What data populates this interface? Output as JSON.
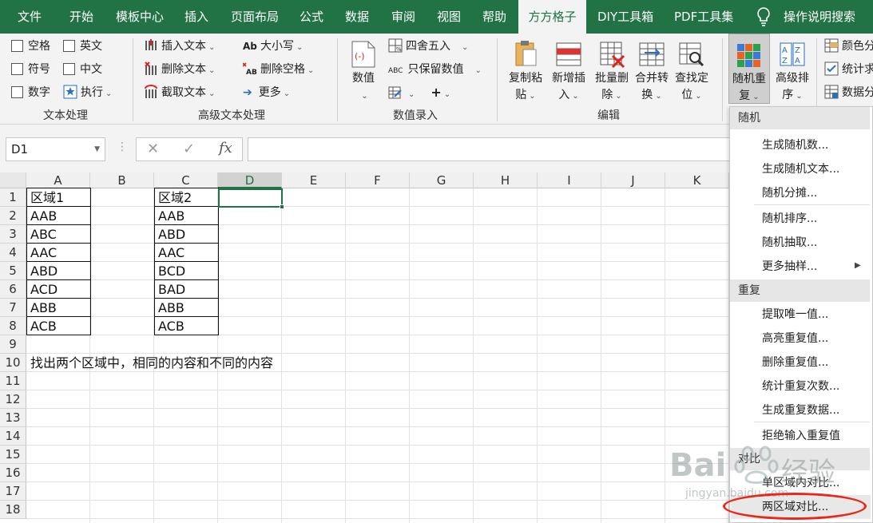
{
  "tabs": [
    "文件",
    "开始",
    "模板中心",
    "插入",
    "页面布局",
    "公式",
    "数据",
    "审阅",
    "视图",
    "帮助",
    "方方格子",
    "DIY工具箱",
    "PDF工具集"
  ],
  "help_label": "操作说明搜索",
  "ribbon": {
    "text": {
      "items": [
        "空格",
        "英文",
        "符号",
        "中文",
        "数字",
        "执行"
      ],
      "group": "文本处理"
    },
    "adv": {
      "items": [
        "插入文本",
        "删除文本",
        "截取文本",
        "大小写",
        "删除空格",
        "更多"
      ],
      "group": "高级文本处理"
    },
    "num": {
      "big": "数值",
      "items": [
        "四舍五入",
        "只保留数值"
      ],
      "group": "数值录入"
    },
    "edit": {
      "buttons": [
        [
          "复制粘",
          "贴"
        ],
        [
          "新增插",
          "入"
        ],
        [
          "批量删",
          "除"
        ],
        [
          "合并转",
          "换"
        ],
        [
          "查找定",
          "位"
        ]
      ],
      "group": "编辑"
    },
    "rand": {
      "buttons": [
        [
          "随机重",
          "复"
        ],
        [
          "高级排",
          "序"
        ]
      ]
    },
    "right": [
      "颜色分",
      "统计求",
      "数据分"
    ]
  },
  "namebox": "D1",
  "columns": [
    "A",
    "B",
    "C",
    "D",
    "E",
    "F",
    "G",
    "H",
    "I",
    "J",
    "K"
  ],
  "rows": [
    "1",
    "2",
    "3",
    "4",
    "5",
    "6",
    "7",
    "8",
    "9",
    "10",
    "11",
    "12",
    "13",
    "14",
    "15",
    "16",
    "17",
    "18"
  ],
  "colA": [
    "区域1",
    "AAB",
    "ABC",
    "AAC",
    "ABD",
    "ACD",
    "ABB",
    "ACB"
  ],
  "colC": [
    "区域2",
    "AAB",
    "ABD",
    "AAC",
    "BCD",
    "BAD",
    "ABB",
    "ACB"
  ],
  "note": "找出两个区域中，相同的内容和不同的内容",
  "menu": {
    "h1": "随机",
    "g1": [
      "生成随机数...",
      "生成随机文本...",
      "随机分摊..."
    ],
    "g2": [
      "随机排序...",
      "随机抽取...",
      "更多抽样..."
    ],
    "h2": "重复",
    "g3": [
      "提取唯一值...",
      "高亮重复值...",
      "删除重复值...",
      "统计重复次数...",
      "生成重复数据..."
    ],
    "g4": [
      "拒绝输入重复值"
    ],
    "h3": "对比",
    "g5": [
      "单区域内对比...",
      "两区域对比..."
    ]
  },
  "watermark": {
    "brand": "Bai",
    "brand2": "经验",
    "url": "jingyan.baidu.com"
  },
  "colors": {
    "accent": "#217346",
    "highlight": "#e8281b"
  }
}
